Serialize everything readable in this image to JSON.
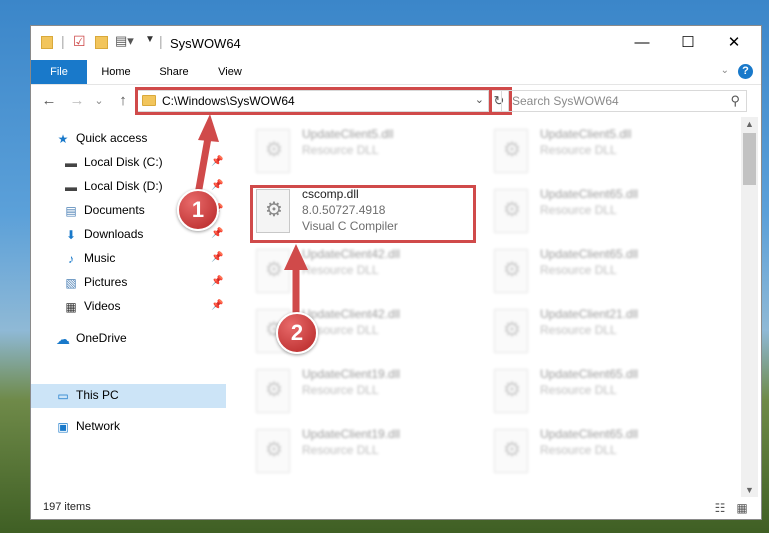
{
  "window": {
    "title": "SysWOW64",
    "controls": {
      "minimize": "—",
      "maximize": "☐",
      "close": "✕"
    }
  },
  "ribbon": {
    "tabs": [
      "File",
      "Home",
      "Share",
      "View"
    ],
    "help": "?"
  },
  "navigation": {
    "back": "←",
    "forward": "→",
    "recent": "⌄",
    "up": "↑",
    "address": "C:\\Windows\\SysWOW64",
    "refresh": "↻",
    "search_placeholder": "Search SysWOW64"
  },
  "sidebar": {
    "items": [
      {
        "label": "Quick access",
        "icon": "star-icon",
        "glyph": "★",
        "color": "#1979ca"
      },
      {
        "label": "Local Disk (C:)",
        "icon": "drive-icon",
        "glyph": "▬",
        "color": "#444"
      },
      {
        "label": "Local Disk (D:)",
        "icon": "drive-icon",
        "glyph": "▬",
        "color": "#444"
      },
      {
        "label": "Documents",
        "icon": "documents-icon",
        "glyph": "▤",
        "color": "#4a7fb5"
      },
      {
        "label": "Downloads",
        "icon": "download-icon",
        "glyph": "⬇",
        "color": "#1979ca"
      },
      {
        "label": "Music",
        "icon": "music-icon",
        "glyph": "♪",
        "color": "#1979ca"
      },
      {
        "label": "Pictures",
        "icon": "pictures-icon",
        "glyph": "▧",
        "color": "#4a7fb5"
      },
      {
        "label": "Videos",
        "icon": "video-icon",
        "glyph": "▦",
        "color": "#333"
      },
      {
        "label": "OneDrive",
        "icon": "cloud-icon",
        "glyph": "☁",
        "color": "#1979ca"
      },
      {
        "label": "This PC",
        "icon": "computer-icon",
        "glyph": "▭",
        "color": "#1979ca"
      },
      {
        "label": "Network",
        "icon": "network-icon",
        "glyph": "▣",
        "color": "#1979ca"
      }
    ],
    "selected": "This PC"
  },
  "files": {
    "highlighted": {
      "name": "cscomp.dll",
      "version": "8.0.50727.4918",
      "description": "Visual C Compiler"
    },
    "blurred": [
      {
        "name": "UpdateClient5.dll",
        "type": "Resource DLL"
      },
      {
        "name": "UpdateClient5.dll",
        "type": "Resource DLL"
      },
      {
        "name": "UpdateClient65.dll",
        "type": "Resource DLL"
      },
      {
        "name": "UpdateClient42.dll",
        "type": "Resource DLL"
      },
      {
        "name": "UpdateClient65.dll",
        "type": "Resource DLL"
      },
      {
        "name": "UpdateClient42.dll",
        "type": "Resource DLL"
      },
      {
        "name": "UpdateClient21.dll",
        "type": "Resource DLL"
      },
      {
        "name": "UpdateClient19.dll",
        "type": "Resource DLL"
      },
      {
        "name": "UpdateClient65.dll",
        "type": "Resource DLL"
      },
      {
        "name": "UpdateClient19.dll",
        "type": "Resource DLL"
      },
      {
        "name": "UpdateClient65.dll",
        "type": "Resource DLL"
      }
    ]
  },
  "status": {
    "item_count": "197 items"
  },
  "annotations": {
    "step1": "1",
    "step2": "2",
    "color": "#d04a4a"
  }
}
